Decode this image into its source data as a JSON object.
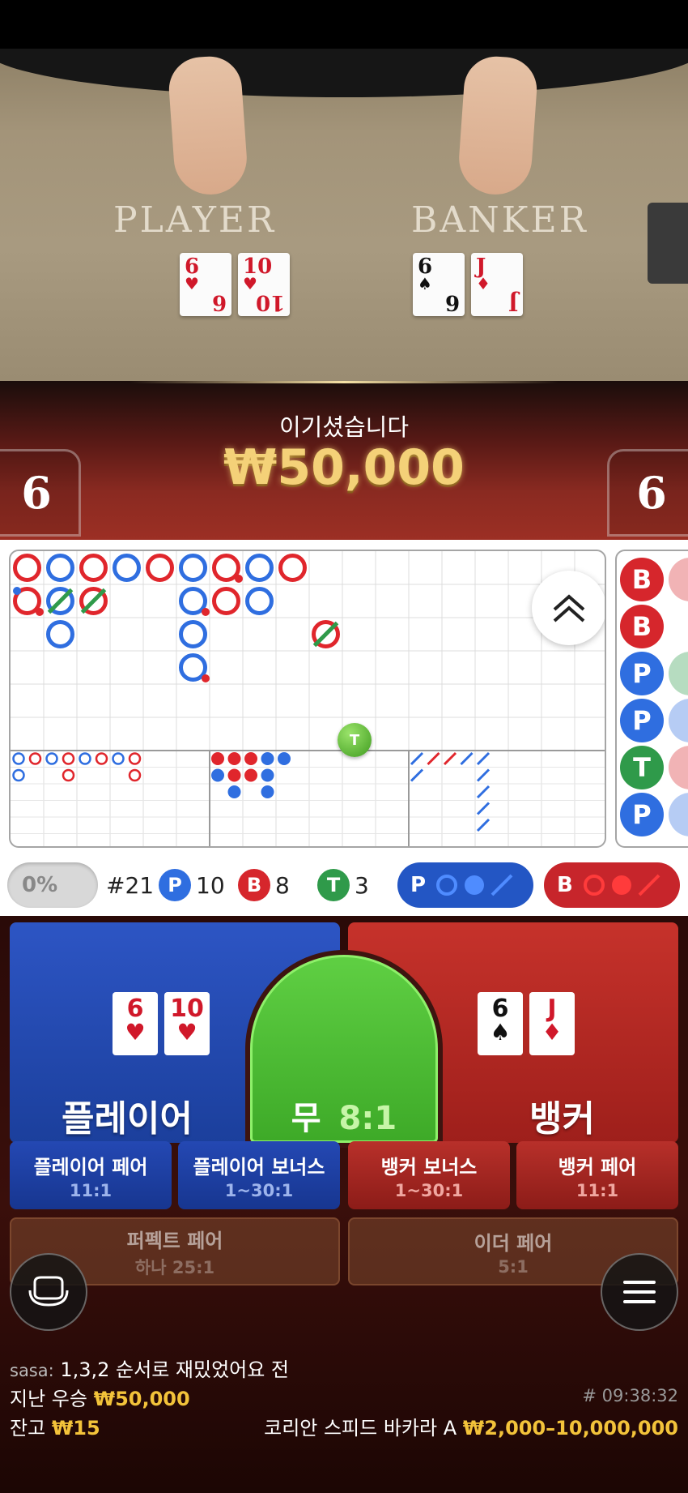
{
  "table_video": {
    "player_label": "PLAYER",
    "banker_label": "BANKER",
    "player_cards": [
      {
        "rank": "6",
        "suit": "♥",
        "color": "#d0182a"
      },
      {
        "rank": "10",
        "suit": "♥",
        "color": "#d0182a"
      }
    ],
    "banker_cards": [
      {
        "rank": "6",
        "suit": "♠",
        "color": "#111111"
      },
      {
        "rank": "J",
        "suit": "♦",
        "color": "#d0182a"
      }
    ]
  },
  "result": {
    "message": "이기셨습니다",
    "amount": "₩50,000",
    "player_score": "6",
    "banker_score": "6"
  },
  "roadmap": {
    "tie_marker": "T",
    "side_pills": [
      "B",
      "B",
      "P",
      "P",
      "T",
      "P"
    ]
  },
  "stats": {
    "percent": "0%",
    "round": "#21",
    "player_letter": "P",
    "player_count": "10",
    "banker_letter": "B",
    "banker_count": "8",
    "tie_letter": "T",
    "tie_count": "3",
    "predict_player": "P",
    "predict_banker": "B"
  },
  "betting": {
    "player_label": "플레이어",
    "banker_label": "뱅커",
    "tie_label": "무",
    "tie_odds": "8:1",
    "player_cards": [
      {
        "rank": "6",
        "suit": "♥",
        "color": "#d0182a"
      },
      {
        "rank": "10",
        "suit": "♥",
        "color": "#d0182a"
      }
    ],
    "banker_cards": [
      {
        "rank": "6",
        "suit": "♠",
        "color": "#111111"
      },
      {
        "rank": "J",
        "suit": "♦",
        "color": "#d0182a"
      }
    ],
    "side_bets": [
      {
        "name": "플레이어 페어",
        "odds": "11:1"
      },
      {
        "name": "플레이어 보너스",
        "odds": "1~30:1"
      },
      {
        "name": "뱅커 보너스",
        "odds": "1~30:1"
      },
      {
        "name": "뱅커 페어",
        "odds": "11:1"
      }
    ],
    "extra_bets": [
      {
        "name": "퍼펙트 페어",
        "odds": "하나 25:1"
      },
      {
        "name": "이더 페어",
        "odds": "5:1"
      }
    ]
  },
  "footer": {
    "chat_user": "sasa:",
    "chat_message": "1,3,2 순서로 재밌었어요 전",
    "last_win_label": "지난 우승",
    "last_win_amount": "₩50,000",
    "balance_label": "잔고",
    "balance_amount": "₩15",
    "time": "# 09:38:32",
    "table_name": "코리안 스피드 바카라 A",
    "limits": "₩2,000–10,000,000"
  },
  "colors": {
    "player_blue": "#2f6ee0",
    "banker_red": "#d6262c",
    "tie_green": "#2f9a4a",
    "gold": "#f3c33a"
  }
}
